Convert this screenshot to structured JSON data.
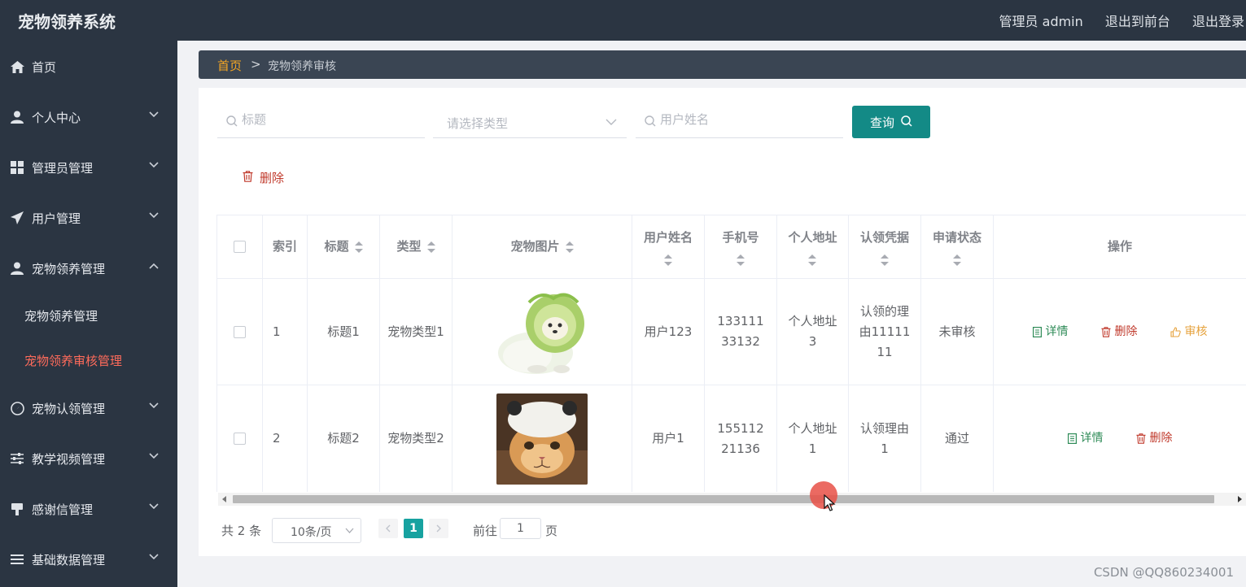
{
  "header": {
    "app_title": "宠物领养系统",
    "user_label": "管理员 admin",
    "front_link": "退出到前台",
    "logout_link": "退出登录"
  },
  "sidebar": {
    "items": [
      {
        "label": "首页",
        "icon": "home-icon"
      },
      {
        "label": "个人中心",
        "icon": "user-icon"
      },
      {
        "label": "管理员管理",
        "icon": "grid-icon"
      },
      {
        "label": "用户管理",
        "icon": "send-icon"
      },
      {
        "label": "宠物领养管理",
        "icon": "user-icon",
        "expanded": true,
        "children": [
          {
            "label": "宠物领养管理"
          },
          {
            "label": "宠物领养审核管理",
            "active": true
          }
        ]
      },
      {
        "label": "宠物认领管理",
        "icon": "compass-icon"
      },
      {
        "label": "教学视频管理",
        "icon": "sliders-icon"
      },
      {
        "label": "感谢信管理",
        "icon": "stamp-icon"
      },
      {
        "label": "基础数据管理",
        "icon": "list-icon"
      }
    ]
  },
  "breadcrumb": {
    "home": "首页",
    "separator": ">",
    "current": "宠物领养审核"
  },
  "search": {
    "title_placeholder": "标题",
    "type_placeholder": "请选择类型",
    "username_placeholder": "用户姓名",
    "query_label": "查询"
  },
  "toolbar": {
    "delete_label": "删除"
  },
  "table": {
    "headers": {
      "index": "索引",
      "title": "标题",
      "type": "类型",
      "image": "宠物图片",
      "username": "用户姓名",
      "phone": "手机号",
      "address": "个人地址",
      "proof": "认领凭据",
      "status": "申请状态",
      "actions": "操作"
    },
    "rows": [
      {
        "index": "1",
        "title": "标题1",
        "type": "宠物类型1",
        "image": "cabbage-dog-photo",
        "username": "用户123",
        "phone": "13311133132",
        "address": "个人地址3",
        "proof": "认领的理由1111111",
        "status": "未审核",
        "actions": [
          "详情",
          "删除",
          "审核"
        ]
      },
      {
        "index": "2",
        "title": "标题2",
        "type": "宠物类型2",
        "image": "cat-with-hat-photo",
        "username": "用户1",
        "phone": "15511221136",
        "address": "个人地址1",
        "proof": "认领理由1",
        "status": "通过",
        "actions": [
          "详情",
          "删除"
        ]
      }
    ]
  },
  "pagination": {
    "total": "共 2 条",
    "page_size": "10条/页",
    "current_page": "1",
    "goto_label": "前往",
    "goto_value": "1",
    "goto_suffix": "页"
  },
  "watermark": "CSDN @QQ860234001",
  "colors": {
    "sidebar_bg": "#2b3542",
    "primary": "#138a86",
    "active_menu": "#ff6b5b",
    "breadcrumb_home": "#f5a623",
    "danger": "#c0392b",
    "success": "#2e8b57",
    "warning": "#e6a23c"
  }
}
